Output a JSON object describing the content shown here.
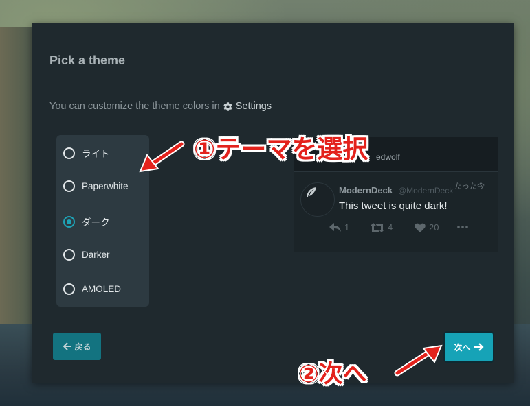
{
  "dialog": {
    "title": "Pick a theme",
    "description_prefix": "You can customize the theme colors in",
    "settings_label": "Settings"
  },
  "themes": [
    {
      "label": "ライト",
      "checked": false
    },
    {
      "label": "Paperwhite",
      "checked": false
    },
    {
      "label": "ダーク",
      "checked": true
    },
    {
      "label": "Darker",
      "checked": false
    },
    {
      "label": "AMOLED",
      "checked": false
    }
  ],
  "preview": {
    "header_handle": "edwolf",
    "tweet": {
      "name": "ModernDeck",
      "username": "@ModernDeck",
      "time": "たった今",
      "text": "This tweet is quite dark!",
      "reply_count": "1",
      "retweet_count": "4",
      "like_count": "20"
    }
  },
  "buttons": {
    "back_label": "戻る",
    "next_label": "次へ"
  },
  "annotations": {
    "step1": "①テーマを選択",
    "step2": "②次へ",
    "color": "#e3221c"
  },
  "colors": {
    "accent": "#16a3b7",
    "dialog_bg": "#1f292e"
  }
}
